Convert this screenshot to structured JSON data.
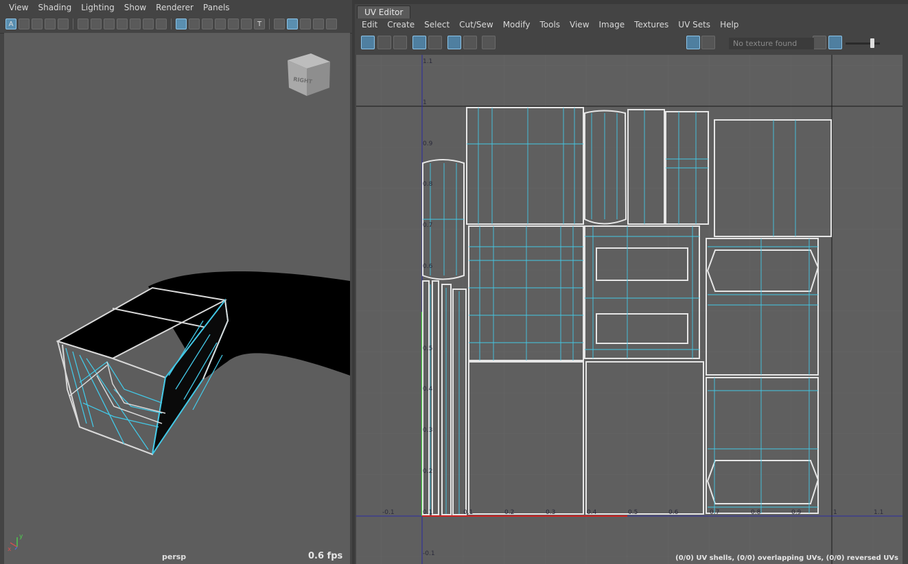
{
  "viewport": {
    "menu": [
      "View",
      "Shading",
      "Lighting",
      "Show",
      "Renderer",
      "Panels"
    ],
    "viewcube_label": "RIGHT",
    "camera": "persp",
    "fps": "0.6 fps",
    "axis_y": "y",
    "axis_x": "x"
  },
  "uv_editor": {
    "tab": "UV Editor",
    "menu": [
      "Edit",
      "Create",
      "Select",
      "Cut/Sew",
      "Modify",
      "Tools",
      "View",
      "Image",
      "Textures",
      "UV Sets",
      "Help"
    ],
    "texture_field": "No texture found",
    "status": "(0/0) UV shells, (0/0) overlapping UVs, (0/0) reversed UVs",
    "x_ticks": [
      "-0.1",
      "0.1",
      "0.2",
      "0.3",
      "0.4",
      "0.5",
      "0.6",
      "0.7",
      "0.8",
      "0.9",
      "1",
      "1.1"
    ],
    "y_ticks": [
      "1.1",
      "1",
      "0.9",
      "0.8",
      "0.7",
      "0.6",
      "0.5",
      "0.4",
      "0.3",
      "0.2",
      "0.1",
      "-0.1"
    ]
  },
  "colors": {
    "wire": "#e6e6e6",
    "wire_selected": "#43c8e6",
    "u_axis": "#2a2aa0",
    "v_axis": "#2a2aa0"
  }
}
